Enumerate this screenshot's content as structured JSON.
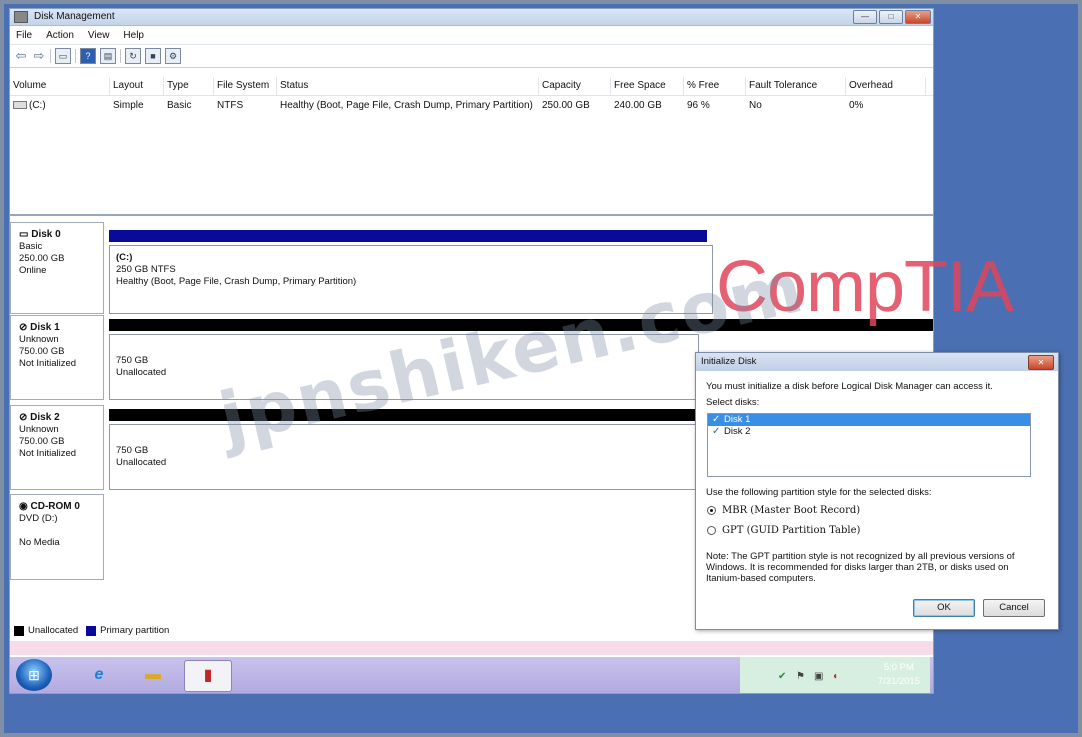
{
  "window": {
    "title": "Disk Management"
  },
  "menu": [
    "File",
    "Action",
    "View",
    "Help"
  ],
  "toolbar_icons": [
    "back-icon",
    "forward-icon",
    "properties-icon",
    "help-icon",
    "console-icon",
    "refresh-icon",
    "rescan-icon",
    "settings-icon"
  ],
  "volume_table": {
    "headers": [
      "Volume",
      "Layout",
      "Type",
      "File System",
      "Status",
      "Capacity",
      "Free Space",
      "% Free",
      "Fault Tolerance",
      "Overhead"
    ],
    "rows": [
      [
        "(C:)",
        "Simple",
        "Basic",
        "NTFS",
        "Healthy (Boot, Page File, Crash Dump, Primary Partition)",
        "250.00 GB",
        "240.00 GB",
        "96 %",
        "No",
        "0%"
      ]
    ]
  },
  "disks": [
    {
      "name": "Disk 0",
      "type": "Basic",
      "size": "250.00 GB",
      "state": "Online",
      "bar_color": "#0a0a9a",
      "part_title": "(C:)",
      "part_line1": "250 GB NTFS",
      "part_line2": "Healthy (Boot, Page File, Crash Dump, Primary Partition)"
    },
    {
      "name": "Disk 1",
      "type": "Unknown",
      "size": "750.00 GB",
      "state": "Not Initialized",
      "bar_color": "#000000",
      "part_line1": "750 GB",
      "part_line2": "Unallocated"
    },
    {
      "name": "Disk 2",
      "type": "Unknown",
      "size": "750.00 GB",
      "state": "Not Initialized",
      "bar_color": "#000000",
      "part_line1": "750 GB",
      "part_line2": "Unallocated"
    },
    {
      "name": "CD-ROM 0",
      "type": "DVD (D:)",
      "state": "No Media"
    }
  ],
  "legend": [
    {
      "label": "Unallocated",
      "color": "#000000"
    },
    {
      "label": "Primary partition",
      "color": "#0a0a9a"
    }
  ],
  "taskbar": {
    "apps": [
      "internet-explorer-icon",
      "file-explorer-icon",
      "toolbox-icon"
    ],
    "time": "5:0 PM",
    "date": "7/31/2015"
  },
  "watermarks": {
    "brand": "CompTIA",
    "site": "jpnshiken.com"
  },
  "dialog": {
    "title": "Initialize Disk",
    "intro": "You must initialize a disk before Logical Disk Manager can access it.",
    "select_label": "Select disks:",
    "disks": [
      {
        "label": "Disk 1",
        "checked": true
      },
      {
        "label": "Disk 2",
        "checked": true
      }
    ],
    "style_label": "Use the following partition style for the selected disks:",
    "options": [
      {
        "label": "MBR (Master Boot Record)",
        "selected": true
      },
      {
        "label": "GPT (GUID Partition Table)",
        "selected": false
      }
    ],
    "note": "Note: The GPT partition style is not recognized by all previous versions of Windows. It is recommended for disks larger than 2TB, or disks used on Itanium-based computers.",
    "ok": "OK",
    "cancel": "Cancel"
  }
}
